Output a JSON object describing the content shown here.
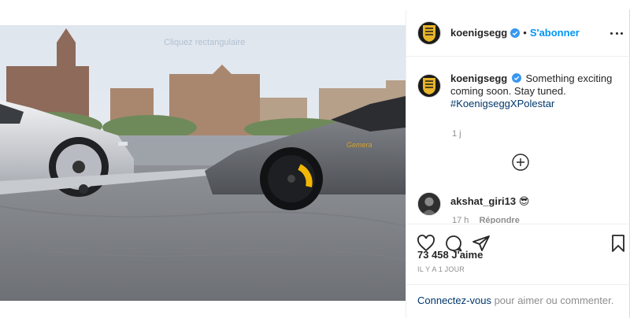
{
  "image": {
    "overlay_text": "Cliquez rectangulaire",
    "badge_text": "Gemera"
  },
  "header": {
    "username": "koenigsegg",
    "separator": "•",
    "follow_label": "S'abonner"
  },
  "caption": {
    "username": "koenigsegg",
    "text": "Something exciting coming soon. Stay tuned.",
    "hashtag": "#KoenigseggXPolestar",
    "time": "1 j"
  },
  "comment": {
    "username": "akshat_giri13",
    "emoji": "😎",
    "time": "17 h",
    "reply_label": "Répondre"
  },
  "actions": {
    "like_icon": "heart-icon",
    "comment_icon": "comment-icon",
    "share_icon": "share-icon",
    "save_icon": "bookmark-icon"
  },
  "likes_text": "73 458 J'aime",
  "date_text": "IL Y A 1 JOUR",
  "login": {
    "link": "Connectez-vous",
    "rest": " pour aimer ou commenter."
  },
  "colors": {
    "accent": "#0095f6",
    "link_dark": "#00376b",
    "muted": "#8e8e8e",
    "brake_caliper": "#f2b705"
  }
}
